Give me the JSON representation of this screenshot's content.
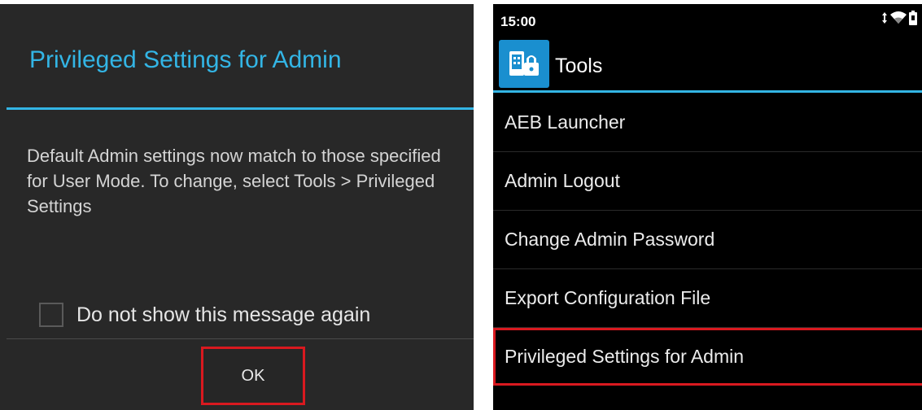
{
  "dialog": {
    "title": "Privileged Settings for Admin",
    "message": "Default Admin settings now match to those specified for User Mode. To change, select Tools > Privileged Settings",
    "checkbox_label": "Do not show this message again",
    "ok_label": "OK"
  },
  "phone": {
    "status_time": "15:00",
    "status_icons": [
      "data-arrows-icon",
      "wifi-icon",
      "battery-icon"
    ],
    "app_icon": "tools-lock-icon",
    "title": "Tools",
    "menu": [
      {
        "label": "AEB Launcher"
      },
      {
        "label": "Admin Logout"
      },
      {
        "label": "Change Admin Password"
      },
      {
        "label": "Export Configuration File"
      },
      {
        "label": "Privileged Settings for Admin"
      }
    ]
  },
  "colors": {
    "accent": "#33b5e5",
    "highlight_box": "#d9191f",
    "dialog_bg": "#282828",
    "phone_bg": "#000000"
  }
}
